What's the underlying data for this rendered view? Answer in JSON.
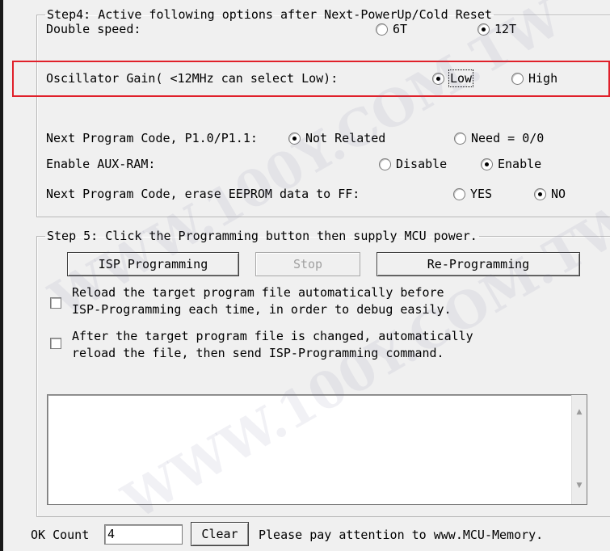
{
  "step4": {
    "legend": "Step4: Active following options after Next-PowerUp/Cold Reset",
    "double_speed": {
      "label": "Double speed:",
      "options": [
        "6T",
        "12T"
      ],
      "selected": "12T"
    },
    "oscillator_gain": {
      "label": "Oscillator Gain( <12MHz can select Low):",
      "options": [
        "Low",
        "High"
      ],
      "selected": "Low"
    },
    "next_program_code": {
      "label": "Next Program Code, P1.0/P1.1:",
      "options": [
        "Not Related",
        "Need = 0/0"
      ],
      "selected": "Not Related"
    },
    "enable_aux_ram": {
      "label": "Enable AUX-RAM:",
      "options": [
        "Disable",
        "Enable"
      ],
      "selected": "Enable"
    },
    "erase_eeprom": {
      "label": "Next Program Code, erase EEPROM data to FF:",
      "options": [
        "YES",
        "NO"
      ],
      "selected": "NO"
    }
  },
  "step5": {
    "legend": "Step 5: Click the Programming button then supply MCU power.",
    "buttons": {
      "isp_programming": "ISP Programming",
      "stop": "Stop",
      "re_programming": "Re-Programming"
    },
    "reload_auto": {
      "line1": "Reload the target program file automatically before",
      "line2": "ISP-Programming each time, in order to debug easily.",
      "checked": false
    },
    "reload_on_change": {
      "line1": "After the target program file is changed, automatically",
      "line2": "reload the file, then send ISP-Programming command.",
      "checked": false
    },
    "log": ""
  },
  "status": {
    "ok_count_label": "OK Count",
    "ok_count_value": "4",
    "clear_button": "Clear",
    "message": "Please pay attention to www.MCU-Memory."
  },
  "watermark": "WWW.100Y.COM.TW"
}
